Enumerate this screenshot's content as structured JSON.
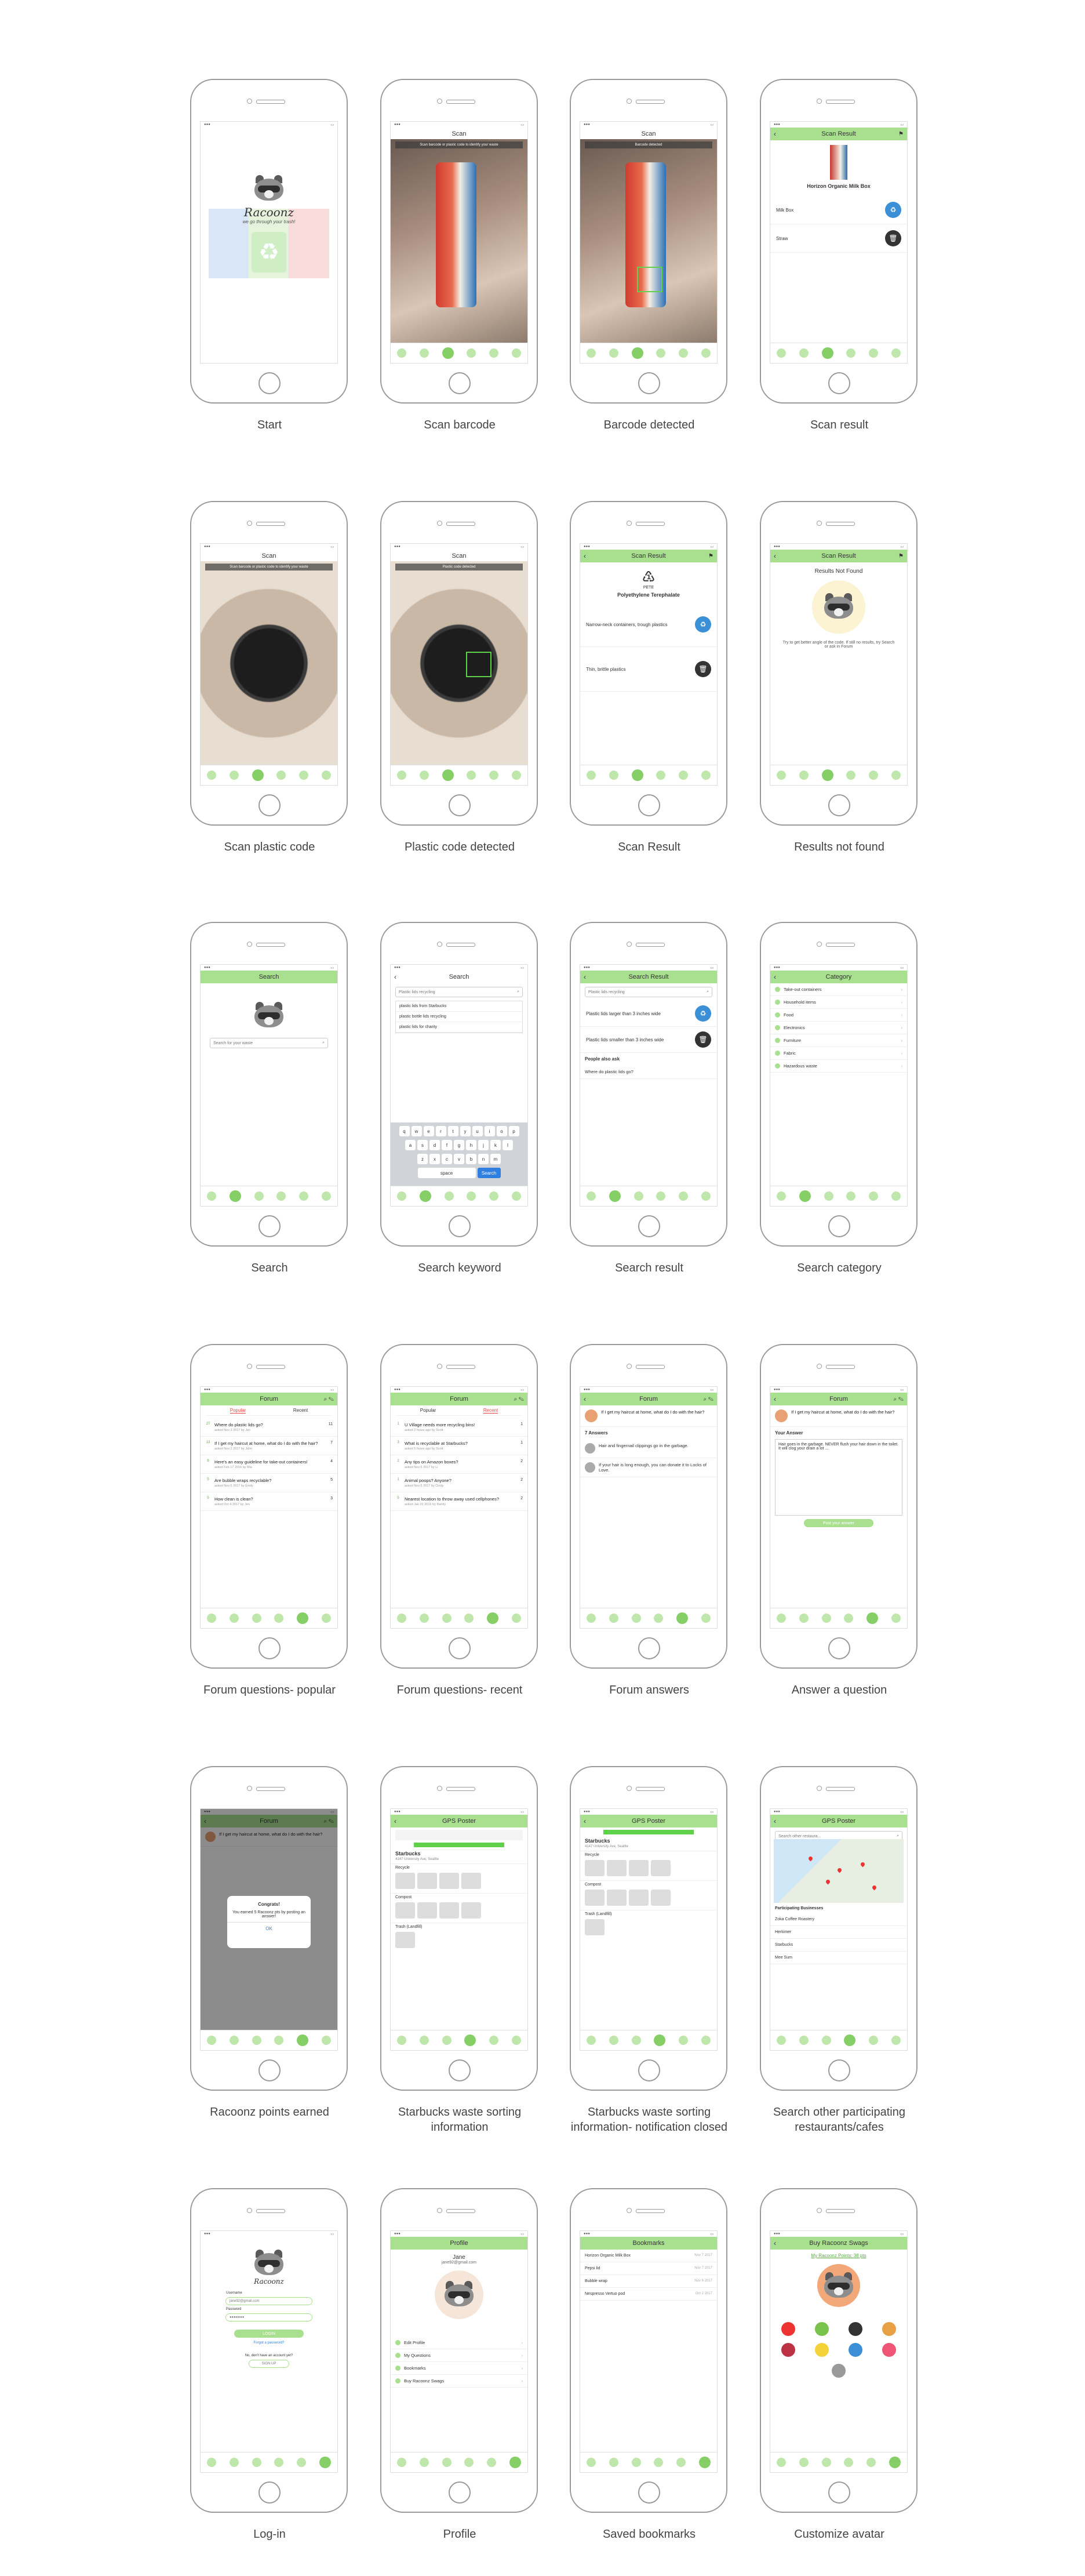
{
  "screens": [
    {
      "caption": "Start",
      "title": "",
      "brand": "Racoonz",
      "tagline": "we go through your trash!"
    },
    {
      "caption": "Scan barcode",
      "title": "Scan",
      "hint": "Scan barcode or plastic code to identify your waste"
    },
    {
      "caption": "Barcode detected",
      "title": "Scan",
      "hint": "Barcode detected"
    },
    {
      "caption": "Scan result",
      "title": "Scan Result",
      "product": "Horizon Organic Milk Box",
      "items": [
        {
          "label": "Milk Box"
        },
        {
          "label": "Straw"
        }
      ]
    },
    {
      "caption": "Scan plastic code",
      "title": "Scan",
      "hint": "Scan barcode or plastic code to identify your waste"
    },
    {
      "caption": "Plastic code detected",
      "title": "Scan",
      "hint": "Plastic code detected"
    },
    {
      "caption": "Scan Result",
      "title": "Scan Result",
      "code": "PETE",
      "material": "Polyethylene Terephalate",
      "desc1": "Narrow-neck containers, trough plastics",
      "desc2": "Thin, brittle plastics"
    },
    {
      "caption": "Results not found",
      "title": "Scan Result",
      "heading": "Results Not Found",
      "msg": "Try to get better angle of the code. If still no results, try Search or ask in Forum"
    },
    {
      "caption": "Search",
      "title": "Search",
      "placeholder": "Search for your waste"
    },
    {
      "caption": "Search keyword",
      "title": "Search",
      "query": "Plastic lids recycling",
      "suggestions": [
        "plastic lids from Starbucks",
        "plastic bottle lids recycling",
        "plastic lids for charity"
      ]
    },
    {
      "caption": "Search result",
      "title": "Search Result",
      "query": "Plastic lids recycling",
      "r1": "Plastic lids larger than 3 inches wide",
      "r2": "Plastic lids smaller than 3 inches wide",
      "also": "People also ask",
      "q": "Where do plastic lids go?"
    },
    {
      "caption": "Search category",
      "title": "Category",
      "cats": [
        "Take-out containers",
        "Household items",
        "Food",
        "Electronics",
        "Furniture",
        "Fabric",
        "Hazardous waste"
      ]
    },
    {
      "caption": "Forum questions- popular",
      "title": "Forum",
      "tabs": [
        "Popular",
        "Recent"
      ],
      "qs": [
        {
          "v": "27",
          "t": "Where do plastic lids go?",
          "m": "asked Nov 3 2017 by Jen",
          "c": "11"
        },
        {
          "v": "13",
          "t": "If I get my haircut at home, what do I do with the hair?",
          "m": "asked Nov 2 2017 by John",
          "c": "7"
        },
        {
          "v": "8",
          "t": "Here's an easy guideline for take-out containers!",
          "m": "asked Feb 17 2016 by Mia",
          "c": "4"
        },
        {
          "v": "5",
          "t": "Are bubble wraps recyclable?",
          "m": "asked Nov 6 2017 by Emily",
          "c": "5"
        },
        {
          "v": "5",
          "t": "How clean is clean?",
          "m": "asked Oct 4 2017 by Jen",
          "c": "3"
        }
      ]
    },
    {
      "caption": "Forum questions- recent",
      "title": "Forum",
      "tabs": [
        "Popular",
        "Recent"
      ],
      "qs": [
        {
          "v": "1",
          "t": "U Village needs more recycling bins!",
          "m": "asked 2 hours ago by Scott",
          "c": "1"
        },
        {
          "v": "3",
          "t": "What is recyclable at Starbucks?",
          "m": "asked 5 hours ago by Scott",
          "c": "1"
        },
        {
          "v": "2",
          "t": "Any tips on Amazon boxes?",
          "m": "asked Nov 6 2017 by Li",
          "c": "2"
        },
        {
          "v": "1",
          "t": "Animal poops? Anyone?",
          "m": "asked Nov 6 2017 by Cindy",
          "c": "2"
        },
        {
          "v": "5",
          "t": "Nearest location to throw away used cellphones?",
          "m": "asked Jan 31 2015 by Randy",
          "c": "2"
        }
      ]
    },
    {
      "caption": "Forum answers",
      "title": "Forum",
      "question": "If I get my haircut at home, what do I do with the hair?",
      "count": "7 Answers",
      "a1": "Hair and fingernail clippings go in the garbage.",
      "a2": "If your hair is long enough, you can donate it to Locks of Love."
    },
    {
      "caption": "Answer a question",
      "title": "Forum",
      "question": "If I get my haircut at home, what do I do with the hair?",
      "label": "Your Answer",
      "answer": "Hair goes in the garbage. NEVER flush your hair down in the toilet. It will clog your drain a lot ...",
      "button": "Post your answer"
    },
    {
      "caption": "Racoonz points earned",
      "title": "Forum",
      "dlg_title": "Congrats!",
      "dlg_msg": "You earned 5 Racoonz pts by posting an answer!",
      "dlg_ok": "OK"
    },
    {
      "caption": "Starbucks waste sorting information",
      "title": "GPS Poster",
      "place": "Starbucks",
      "addr": "4147 University Ave, Seattle",
      "sections": [
        "Recycle",
        "Compost",
        "Trash (Landfill)"
      ]
    },
    {
      "caption": "Starbucks waste sorting information- notification closed",
      "title": "GPS Poster",
      "place": "Starbucks",
      "addr": "4147 University Ave, Seattle",
      "sections": [
        "Recycle",
        "Compost",
        "Trash (Landfill)"
      ]
    },
    {
      "caption": "Search other participating restaurants/cafes",
      "title": "GPS Poster",
      "placeholder": "Search other restaura...",
      "list_title": "Participating Businesses",
      "list": [
        "Zoka Coffee Roastery",
        "Herkimer",
        "Starbucks",
        "Mee Sum"
      ]
    },
    {
      "caption": "Log-in",
      "title": "",
      "brand": "Racoonz",
      "user_label": "Username",
      "user_value": "jane92@gmail.com",
      "pass_label": "Password",
      "button": "LOGIN",
      "forgot": "Forgot a password?",
      "noacct": "No, don't have an account yet?",
      "signup": "SIGN UP"
    },
    {
      "caption": "Profile",
      "title": "Profile",
      "name": "Jane",
      "email": "jane92@gmail.com",
      "menu": [
        "Edit Profile",
        "My Questions",
        "Bookmarks",
        "Buy Racoonz Swags"
      ]
    },
    {
      "caption": "Saved bookmarks",
      "title": "Bookmarks",
      "items": [
        {
          "t": "Horizon Organic Milk Box",
          "d": "Nov 7 2017"
        },
        {
          "t": "Pepsi lid",
          "d": "Nov 7 2017"
        },
        {
          "t": "Bubble wrap",
          "d": "Nov 6 2017"
        },
        {
          "t": "Nespresso Vertuo pod",
          "d": "Oct 2 2017"
        }
      ]
    },
    {
      "caption": "Customize avatar",
      "title": "Buy Racoonz Swags",
      "points": "My Racoonz Points: 38 pts"
    }
  ],
  "colors": {
    "accent": "#a8e08f",
    "accent_dark": "#86cf67",
    "blue": "#3a8fd6",
    "dark": "#333333",
    "alert": "#e44444"
  },
  "tab_icons": [
    "home-icon",
    "search-icon",
    "scan-icon",
    "location-icon",
    "forum-icon",
    "profile-icon"
  ]
}
